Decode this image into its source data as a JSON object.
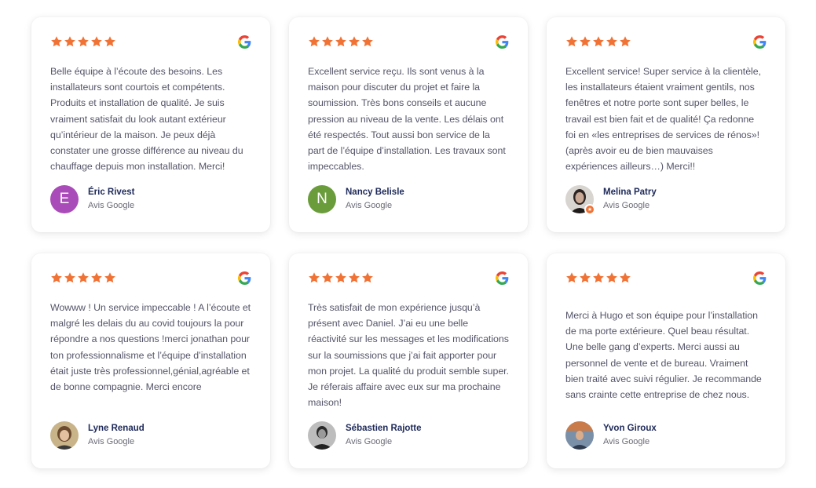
{
  "colors": {
    "star": "#f07235",
    "author_name": "#1e2a5a",
    "avatar_e": "#a94bb8",
    "avatar_n": "#6a9c3c"
  },
  "icons": {
    "rating": "star-icon",
    "source": "google-icon"
  },
  "reviews": [
    {
      "rating": 5,
      "text": "Belle équipe à l’écoute des besoins. Les installateurs sont courtois et compétents. Produits et installation de qualité. Je suis vraiment satisfait du look autant extérieur qu’intérieur de la maison. Je peux déjà constater une grosse différence au niveau du chauffage depuis mon installation. Merci!",
      "author": "Éric Rivest",
      "source": "Avis Google",
      "avatar": "E"
    },
    {
      "rating": 5,
      "text": "Excellent service reçu.  Ils sont venus à la maison pour discuter du projet et faire la soumission. Très bons conseils et aucune pression au niveau de la vente. Les délais ont été respectés. Tout aussi bon service de la part de l’équipe d’installation.  Les travaux sont impeccables.",
      "author": "Nancy Belisle",
      "source": "Avis Google",
      "avatar": "N"
    },
    {
      "rating": 5,
      "text": "Excellent service! Super service à la clientèle, les installateurs étaient vraiment gentils, nos fenêtres et notre porte sont super belles, le travail est bien fait et de qualité! Ça redonne foi en «les entreprises de services de rénos»! (après avoir eu de bien mauvaises expériences ailleurs…) Merci!!",
      "author": "Melina Patry",
      "source": "Avis Google",
      "avatar": ""
    },
    {
      "rating": 5,
      "text": "Wowww ! Un service impeccable ! A l’écoute et malgré les delais du au covid toujours la pour répondre a nos questions !merci jonathan pour ton professionnalisme et l’équipe d’installation était juste très professionnel,génial,agréable et de bonne compagnie. Merci encore",
      "author": "Lyne Renaud",
      "source": "Avis Google",
      "avatar": ""
    },
    {
      "rating": 5,
      "text": "Très satisfait de mon expérience jusqu’à présent avec  Daniel. J’ai eu une belle réactivité sur les messages et les modifications sur la soumissions que j’ai fait apporter pour mon projet. La qualité du produit semble super. Je réferais affaire avec eux sur ma prochaine maison!",
      "author": "Sébastien Rajotte",
      "source": "Avis Google",
      "avatar": ""
    },
    {
      "rating": 5,
      "text": "Merci à Hugo et son équipe pour l’installation de ma porte extérieure. Quel beau résultat. Une belle gang d’experts. Merci aussi au personnel de vente et de bureau. Vraiment bien traité avec suivi régulier. Je recommande sans crainte cette entreprise de chez nous.",
      "author": "Yvon Giroux",
      "source": "Avis Google",
      "avatar": ""
    }
  ]
}
